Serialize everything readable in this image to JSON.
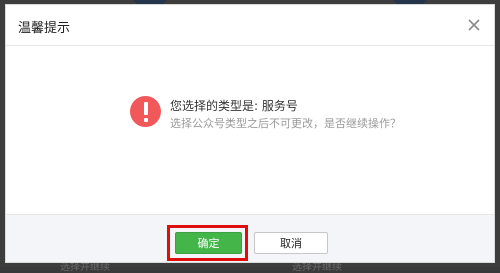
{
  "dialog": {
    "title": "温馨提示",
    "close_icon": "close-icon",
    "warning_icon": "exclamation-circle-icon",
    "message_main": "您选择的类型是: 服务号",
    "message_sub": "选择公众号类型之后不可更改，是否继续操作？",
    "confirm_label": "确定",
    "cancel_label": "取消"
  },
  "background": {
    "left_text": "选择并继续",
    "right_text": "选择并继续"
  },
  "colors": {
    "confirm_button": "#44b549",
    "warning_icon": "#f0585a",
    "highlight_box": "#e00d0d",
    "overlay": "#3d3d3d"
  }
}
